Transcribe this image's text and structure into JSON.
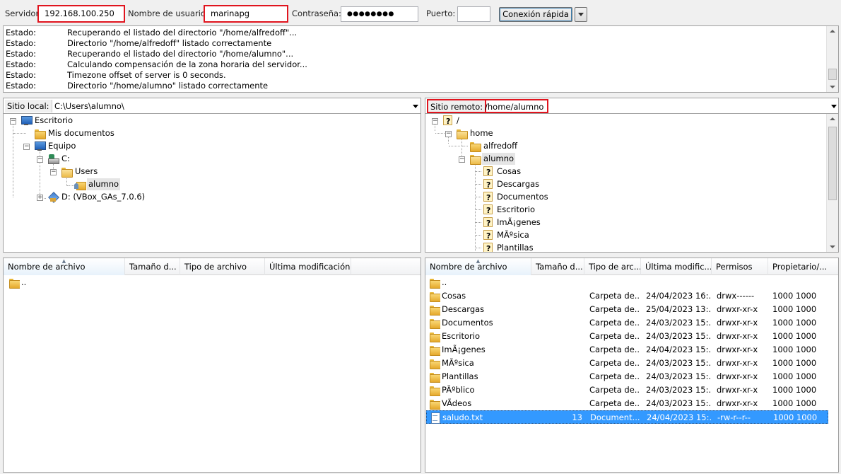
{
  "quickconnect": {
    "host_label": "Servidor:",
    "host_value": "192.168.100.250",
    "user_label": "Nombre de usuario:",
    "user_value": "marinapg",
    "pass_label": "Contraseña:",
    "pass_value": "●●●●●●●●",
    "port_label": "Puerto:",
    "port_value": "",
    "connect_label": "Conexión rápida"
  },
  "log": [
    {
      "k": "Estado:",
      "v": "Recuperando el listado del directorio \"/home/alfredoff\"..."
    },
    {
      "k": "Estado:",
      "v": "Directorio \"/home/alfredoff\" listado correctamente"
    },
    {
      "k": "Estado:",
      "v": "Recuperando el listado del directorio \"/home/alumno\"..."
    },
    {
      "k": "Estado:",
      "v": "Calculando compensación de la zona horaria del servidor..."
    },
    {
      "k": "Estado:",
      "v": "Timezone offset of server is 0 seconds."
    },
    {
      "k": "Estado:",
      "v": "Directorio \"/home/alumno\" listado correctamente"
    }
  ],
  "local": {
    "site_label": "Sitio local:",
    "site_path": "C:\\Users\\alumno\\",
    "tree": [
      "Escritorio",
      "Mis documentos",
      "Equipo",
      "C:",
      "Users",
      "alumno",
      "D: (VBox_GAs_7.0.6)"
    ],
    "columns": [
      "Nombre de archivo",
      "Tamaño d...",
      "Tipo de archivo",
      "Última modificación"
    ],
    "files": [
      ".."
    ]
  },
  "remote": {
    "site_label": "Sitio remoto:",
    "site_path": "/home/alumno",
    "tree": [
      "/",
      "home",
      "alfredoff",
      "alumno",
      "Cosas",
      "Descargas",
      "Documentos",
      "Escritorio",
      "ImÃ¡genes",
      "MÃºsica",
      "Plantillas"
    ],
    "columns": [
      "Nombre de archivo",
      "Tamaño d...",
      "Tipo de arc...",
      "Última modific...",
      "Permisos",
      "Propietario/..."
    ],
    "files": [
      {
        "name": "..",
        "size": "",
        "type": "",
        "mod": "",
        "perm": "",
        "owner": ""
      },
      {
        "name": "Cosas",
        "size": "",
        "type": "Carpeta de...",
        "mod": "24/04/2023 16:...",
        "perm": "drwx------",
        "owner": "1000 1000"
      },
      {
        "name": "Descargas",
        "size": "",
        "type": "Carpeta de...",
        "mod": "25/04/2023 13:...",
        "perm": "drwxr-xr-x",
        "owner": "1000 1000"
      },
      {
        "name": "Documentos",
        "size": "",
        "type": "Carpeta de...",
        "mod": "24/03/2023 15:...",
        "perm": "drwxr-xr-x",
        "owner": "1000 1000"
      },
      {
        "name": "Escritorio",
        "size": "",
        "type": "Carpeta de...",
        "mod": "24/03/2023 15:...",
        "perm": "drwxr-xr-x",
        "owner": "1000 1000"
      },
      {
        "name": "ImÃ¡genes",
        "size": "",
        "type": "Carpeta de...",
        "mod": "24/04/2023 15:...",
        "perm": "drwxr-xr-x",
        "owner": "1000 1000"
      },
      {
        "name": "MÃºsica",
        "size": "",
        "type": "Carpeta de...",
        "mod": "24/03/2023 15:...",
        "perm": "drwxr-xr-x",
        "owner": "1000 1000"
      },
      {
        "name": "Plantillas",
        "size": "",
        "type": "Carpeta de...",
        "mod": "24/03/2023 15:...",
        "perm": "drwxr-xr-x",
        "owner": "1000 1000"
      },
      {
        "name": "PÃºblico",
        "size": "",
        "type": "Carpeta de...",
        "mod": "24/03/2023 15:...",
        "perm": "drwxr-xr-x",
        "owner": "1000 1000"
      },
      {
        "name": "VÃ­deos",
        "size": "",
        "type": "Carpeta de...",
        "mod": "24/03/2023 15:...",
        "perm": "drwxr-xr-x",
        "owner": "1000 1000"
      },
      {
        "name": "saludo.txt",
        "size": "13",
        "type": "Document...",
        "mod": "24/04/2023 15:...",
        "perm": "-rw-r--r--",
        "owner": "1000 1000"
      }
    ]
  },
  "icons": {
    "folder": "folder-icon",
    "unknown_folder": "unknown-folder-icon",
    "desktop": "desktop-icon",
    "computer": "computer-icon",
    "drive": "drive-icon",
    "user_folder": "user-folder-icon",
    "text_file": "text-file-icon"
  },
  "colors": {
    "highlight_border": "#e0141e",
    "selection": "#3399ff"
  }
}
